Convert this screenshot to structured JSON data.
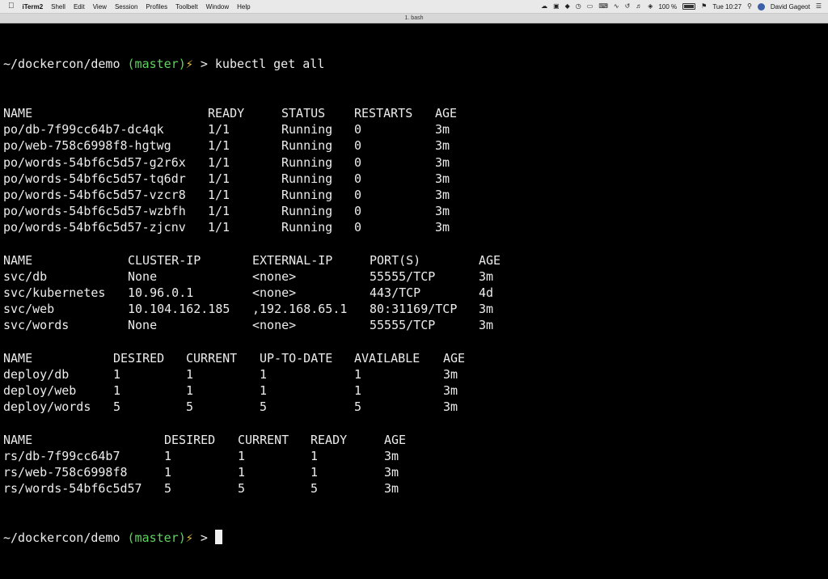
{
  "menubar": {
    "apple": "",
    "app": "iTerm2",
    "menus": [
      "Shell",
      "Edit",
      "View",
      "Session",
      "Profiles",
      "Toolbelt",
      "Window",
      "Help"
    ],
    "battery": "100 %",
    "clock": "Tue 10:27",
    "user": "David Gageot"
  },
  "window": {
    "title": "1. bash"
  },
  "prompt": {
    "path": "~/dockercon/demo",
    "branch": "(master)",
    "bolt": "⚡",
    "arrow": ">"
  },
  "command": "kubectl get all",
  "pods": {
    "headers": [
      "NAME",
      "READY",
      "STATUS",
      "RESTARTS",
      "AGE"
    ],
    "rows": [
      [
        "po/db-7f99cc64b7-dc4qk",
        "1/1",
        "Running",
        "0",
        "3m"
      ],
      [
        "po/web-758c6998f8-hgtwg",
        "1/1",
        "Running",
        "0",
        "3m"
      ],
      [
        "po/words-54bf6c5d57-g2r6x",
        "1/1",
        "Running",
        "0",
        "3m"
      ],
      [
        "po/words-54bf6c5d57-tq6dr",
        "1/1",
        "Running",
        "0",
        "3m"
      ],
      [
        "po/words-54bf6c5d57-vzcr8",
        "1/1",
        "Running",
        "0",
        "3m"
      ],
      [
        "po/words-54bf6c5d57-wzbfh",
        "1/1",
        "Running",
        "0",
        "3m"
      ],
      [
        "po/words-54bf6c5d57-zjcnv",
        "1/1",
        "Running",
        "0",
        "3m"
      ]
    ]
  },
  "services": {
    "headers": [
      "NAME",
      "CLUSTER-IP",
      "EXTERNAL-IP",
      "PORT(S)",
      "AGE"
    ],
    "rows": [
      [
        "svc/db",
        "None",
        "<none>",
        "55555/TCP",
        "3m"
      ],
      [
        "svc/kubernetes",
        "10.96.0.1",
        "<none>",
        "443/TCP",
        "4d"
      ],
      [
        "svc/web",
        "10.104.162.185",
        ",192.168.65.1",
        "80:31169/TCP",
        "3m"
      ],
      [
        "svc/words",
        "None",
        "<none>",
        "55555/TCP",
        "3m"
      ]
    ]
  },
  "deployments": {
    "headers": [
      "NAME",
      "DESIRED",
      "CURRENT",
      "UP-TO-DATE",
      "AVAILABLE",
      "AGE"
    ],
    "rows": [
      [
        "deploy/db",
        "1",
        "1",
        "1",
        "1",
        "3m"
      ],
      [
        "deploy/web",
        "1",
        "1",
        "1",
        "1",
        "3m"
      ],
      [
        "deploy/words",
        "5",
        "5",
        "5",
        "5",
        "3m"
      ]
    ]
  },
  "replicasets": {
    "headers": [
      "NAME",
      "DESIRED",
      "CURRENT",
      "READY",
      "AGE"
    ],
    "rows": [
      [
        "rs/db-7f99cc64b7",
        "1",
        "1",
        "1",
        "3m"
      ],
      [
        "rs/web-758c6998f8",
        "1",
        "1",
        "1",
        "3m"
      ],
      [
        "rs/words-54bf6c5d57",
        "5",
        "5",
        "5",
        "3m"
      ]
    ]
  }
}
